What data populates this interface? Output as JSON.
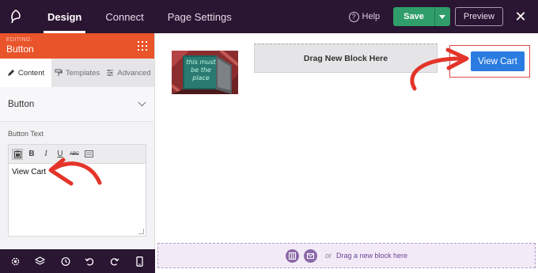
{
  "header": {
    "tabs": [
      {
        "label": "Design",
        "active": true
      },
      {
        "label": "Connect",
        "active": false
      },
      {
        "label": "Page Settings",
        "active": false
      }
    ],
    "help_label": "Help",
    "save_label": "Save",
    "preview_label": "Preview"
  },
  "panel": {
    "editing_label": "EDITING:",
    "module_name": "Button",
    "subtabs": [
      {
        "label": "Content",
        "icon": "pencil-icon",
        "active": true
      },
      {
        "label": "Templates",
        "icon": "paint-roller-icon",
        "active": false
      },
      {
        "label": "Advanced",
        "icon": "sliders-icon",
        "active": false
      }
    ],
    "section_title": "Button",
    "field_label": "Button Text",
    "field_value": "View Cart"
  },
  "canvas": {
    "image_text": "this must be the place",
    "drag_block_label": "Drag New Block Here",
    "button_label": "View Cart",
    "drop_or": "or",
    "drop_link": "Drag a new block here"
  },
  "colors": {
    "topbar": "#2a1532",
    "panel_header": "#e9542a",
    "save": "#2f9e6a",
    "view_cart": "#2b7ce0",
    "annotation": "#e4342a"
  }
}
